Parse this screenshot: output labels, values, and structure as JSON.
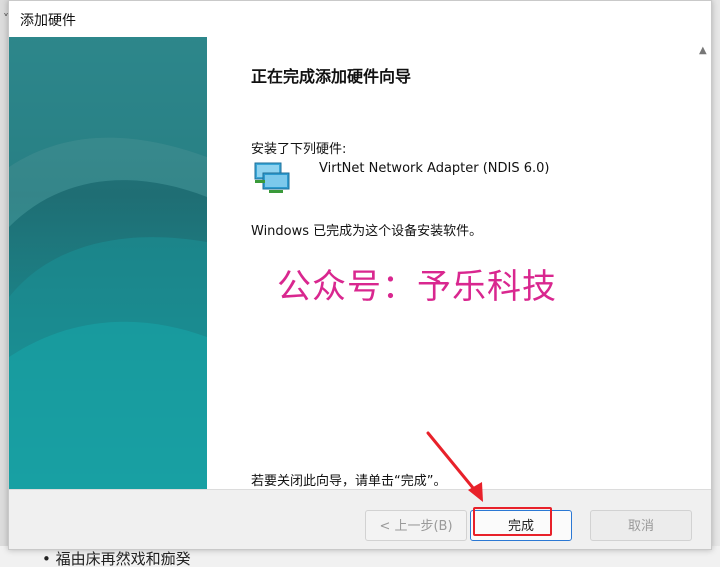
{
  "window": {
    "title": "添加硬件"
  },
  "wizard": {
    "heading": "正在完成添加硬件向导",
    "installed_label": "安装了下列硬件:",
    "device_name": "VirtNet Network Adapter (NDIS 6.0)",
    "done_text": "Windows 已完成为这个设备安装软件。",
    "close_hint": "若要关闭此向导，请单击“完成”。"
  },
  "watermark": {
    "text": "公众号：予乐科技",
    "color": "#d9278f"
  },
  "buttons": {
    "back": "< 上一步(B)",
    "finish": "完成",
    "cancel": "取消"
  },
  "background": {
    "strip_text": "• 福由床再然戏和痂癸"
  },
  "icons": {
    "device": "network-adapter-icon",
    "scroll": "chevron-up-icon"
  },
  "colors": {
    "accent": "#2b78d4",
    "highlight": "#e8212a",
    "banner": "#1f6e74"
  }
}
